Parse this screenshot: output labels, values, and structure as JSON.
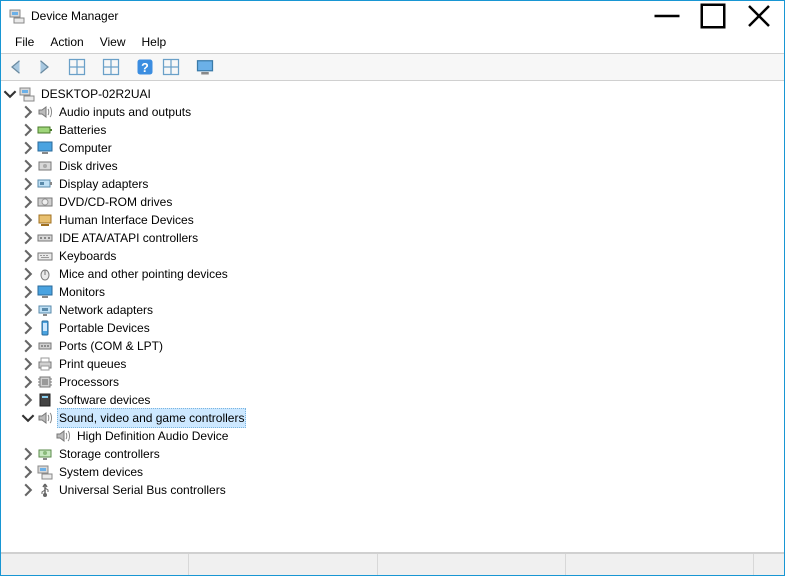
{
  "window": {
    "title": "Device Manager"
  },
  "menubar": {
    "items": [
      "File",
      "Action",
      "View",
      "Help"
    ]
  },
  "toolbar": {
    "back": "Back",
    "forward": "Forward",
    "show_hidden": "Show hidden devices",
    "properties": "Properties",
    "help": "Help",
    "scan": "Scan for hardware changes",
    "extra": "Add legacy hardware"
  },
  "tree": {
    "root": {
      "label": "DESKTOP-02R2UAI",
      "expanded": true,
      "icon": "computer-root-icon"
    },
    "categories": [
      {
        "label": "Audio inputs and outputs",
        "icon": "speaker-icon",
        "expanded": false
      },
      {
        "label": "Batteries",
        "icon": "battery-icon",
        "expanded": false
      },
      {
        "label": "Computer",
        "icon": "monitor-icon",
        "expanded": false
      },
      {
        "label": "Disk drives",
        "icon": "disk-icon",
        "expanded": false
      },
      {
        "label": "Display adapters",
        "icon": "display-adapter-icon",
        "expanded": false
      },
      {
        "label": "DVD/CD-ROM drives",
        "icon": "optical-drive-icon",
        "expanded": false
      },
      {
        "label": "Human Interface Devices",
        "icon": "hid-icon",
        "expanded": false
      },
      {
        "label": "IDE ATA/ATAPI controllers",
        "icon": "ide-icon",
        "expanded": false
      },
      {
        "label": "Keyboards",
        "icon": "keyboard-icon",
        "expanded": false
      },
      {
        "label": "Mice and other pointing devices",
        "icon": "mouse-icon",
        "expanded": false
      },
      {
        "label": "Monitors",
        "icon": "monitor-icon",
        "expanded": false
      },
      {
        "label": "Network adapters",
        "icon": "network-icon",
        "expanded": false
      },
      {
        "label": "Portable Devices",
        "icon": "portable-icon",
        "expanded": false
      },
      {
        "label": "Ports (COM & LPT)",
        "icon": "port-icon",
        "expanded": false
      },
      {
        "label": "Print queues",
        "icon": "printer-icon",
        "expanded": false
      },
      {
        "label": "Processors",
        "icon": "cpu-icon",
        "expanded": false
      },
      {
        "label": "Software devices",
        "icon": "software-icon",
        "expanded": false
      },
      {
        "label": "Sound, video and game controllers",
        "icon": "sound-icon",
        "expanded": true,
        "selected": true,
        "children": [
          {
            "label": "High Definition Audio Device",
            "icon": "sound-icon"
          }
        ]
      },
      {
        "label": "Storage controllers",
        "icon": "storage-icon",
        "expanded": false
      },
      {
        "label": "System devices",
        "icon": "system-icon",
        "expanded": false
      },
      {
        "label": "Universal Serial Bus controllers",
        "icon": "usb-icon",
        "expanded": false
      }
    ]
  }
}
